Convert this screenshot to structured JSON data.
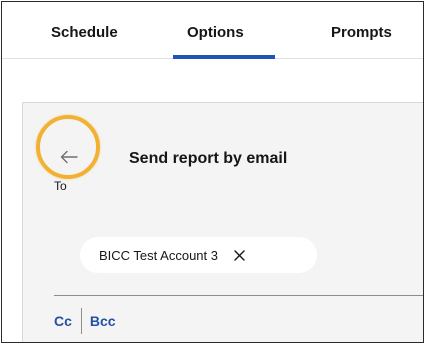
{
  "tabs": [
    {
      "label": "Schedule",
      "active": false
    },
    {
      "label": "Options",
      "active": true
    },
    {
      "label": "Prompts",
      "active": false
    }
  ],
  "panel": {
    "heading": "Send report by email",
    "back_icon": "arrow-left-icon",
    "to_label": "To",
    "recipients": [
      {
        "label": "BICC Test Account 3",
        "remove_icon": "close-icon"
      }
    ],
    "cc_label": "Cc",
    "bcc_label": "Bcc"
  },
  "colors": {
    "accent": "#1f54b4",
    "highlight_ring": "#f2b132",
    "link": "#2451a6",
    "panel_bg": "#f4f4f4"
  }
}
